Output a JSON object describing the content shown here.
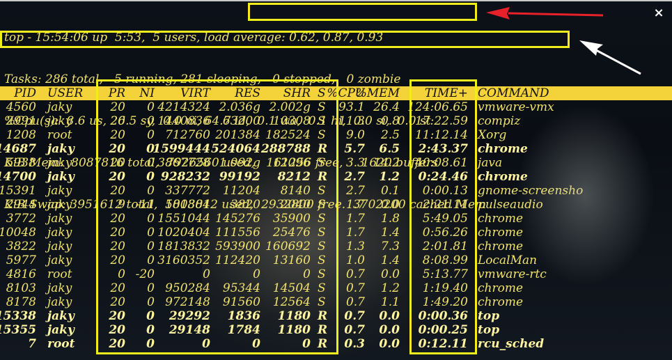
{
  "summary": {
    "line1": "top - 15:54:06 up  5:53,  5 users,",
    "load": " load average: 0.62, 0.87, 0.93",
    "tasks": "Tasks: 286 total,   5 running, 281 sleeping,   0 stopped,   0 zombie",
    "cpu": "%Cpu(s):  8.6 us, 26.5 sy,  0.0 ni, 64.7 id,  0.1 wa,  0.1 hi,  0.0 si,  0.0 st",
    "mem": "KiB Mem:  8087816 total,  7926560 used,   161256 free,     1620 buffers",
    "swap": "KiB Swap: 3951612 total,  1018812 used,  2932800 free.  3702200 cached Mem"
  },
  "columns": [
    "PID",
    "USER",
    "PR",
    "NI",
    "VIRT",
    "RES",
    "SHR",
    "S",
    "%CPU",
    "%MEM",
    "TIME+",
    "COMMAND"
  ],
  "processes": [
    {
      "pid": "4560",
      "user": "jaky",
      "pr": "20",
      "ni": "0",
      "virt": "4214324",
      "res": "2.036g",
      "shr": "2.002g",
      "s": "S",
      "cpu": "93.1",
      "mem": "26.4",
      "time": "124:06.65",
      "cmd": "vmware-vmx",
      "bold": false
    },
    {
      "pid": "2991",
      "user": "jaky",
      "pr": "20",
      "ni": "0",
      "virt": "1440836",
      "res": "63200",
      "shr": "10308",
      "s": "S",
      "cpu": "11.3",
      "mem": "0.8",
      "time": "17:22.59",
      "cmd": "compiz",
      "bold": false
    },
    {
      "pid": "1208",
      "user": "root",
      "pr": "20",
      "ni": "0",
      "virt": "712760",
      "res": "201384",
      "shr": "182524",
      "s": "S",
      "cpu": "9.0",
      "mem": "2.5",
      "time": "11:12.14",
      "cmd": "Xorg",
      "bold": false
    },
    {
      "pid": "14687",
      "user": "jaky",
      "pr": "20",
      "ni": "0",
      "virt": "1599444",
      "res": "524064",
      "shr": "288788",
      "s": "R",
      "cpu": "5.7",
      "mem": "6.5",
      "time": "2:43.37",
      "cmd": "chrome",
      "bold": true
    },
    {
      "pid": "5938",
      "user": "jaky",
      "pr": "20",
      "ni": "0",
      "virt": "3867728",
      "res": "1.092g",
      "shr": "12096",
      "s": "S",
      "cpu": "3.3",
      "mem": "14.2",
      "time": "40:08.61",
      "cmd": "java",
      "bold": false
    },
    {
      "pid": "14700",
      "user": "jaky",
      "pr": "20",
      "ni": "0",
      "virt": "928232",
      "res": "99192",
      "shr": "8212",
      "s": "R",
      "cpu": "2.7",
      "mem": "1.2",
      "time": "0:24.46",
      "cmd": "chrome",
      "bold": true
    },
    {
      "pid": "15391",
      "user": "jaky",
      "pr": "20",
      "ni": "0",
      "virt": "337772",
      "res": "11204",
      "shr": "8140",
      "s": "S",
      "cpu": "2.7",
      "mem": "0.1",
      "time": "0:00.13",
      "cmd": "gnome-screensho",
      "bold": false
    },
    {
      "pid": "2944",
      "user": "jaky",
      "pr": "9",
      "ni": "-11",
      "virt": "580304",
      "res": "3820",
      "shr": "2040",
      "s": "S",
      "cpu": "1.7",
      "mem": "0.0",
      "time": "2:21.11",
      "cmd": "pulseaudio",
      "bold": false
    },
    {
      "pid": "3772",
      "user": "jaky",
      "pr": "20",
      "ni": "0",
      "virt": "1551044",
      "res": "145276",
      "shr": "35900",
      "s": "S",
      "cpu": "1.7",
      "mem": "1.8",
      "time": "5:49.05",
      "cmd": "chrome",
      "bold": false
    },
    {
      "pid": "10048",
      "user": "jaky",
      "pr": "20",
      "ni": "0",
      "virt": "1020404",
      "res": "111556",
      "shr": "25476",
      "s": "S",
      "cpu": "1.7",
      "mem": "1.4",
      "time": "0:56.26",
      "cmd": "chrome",
      "bold": false
    },
    {
      "pid": "3822",
      "user": "jaky",
      "pr": "20",
      "ni": "0",
      "virt": "1813832",
      "res": "593900",
      "shr": "160692",
      "s": "S",
      "cpu": "1.3",
      "mem": "7.3",
      "time": "2:01.81",
      "cmd": "chrome",
      "bold": false
    },
    {
      "pid": "5977",
      "user": "jaky",
      "pr": "20",
      "ni": "0",
      "virt": "3160352",
      "res": "112420",
      "shr": "13160",
      "s": "S",
      "cpu": "1.0",
      "mem": "1.4",
      "time": "8:08.99",
      "cmd": "LocalMan",
      "bold": false
    },
    {
      "pid": "4816",
      "user": "root",
      "pr": "0",
      "ni": "-20",
      "virt": "0",
      "res": "0",
      "shr": "0",
      "s": "S",
      "cpu": "0.7",
      "mem": "0.0",
      "time": "5:13.77",
      "cmd": "vmware-rtc",
      "bold": false
    },
    {
      "pid": "8103",
      "user": "jaky",
      "pr": "20",
      "ni": "0",
      "virt": "950284",
      "res": "95344",
      "shr": "14504",
      "s": "S",
      "cpu": "0.7",
      "mem": "1.2",
      "time": "1:19.40",
      "cmd": "chrome",
      "bold": false
    },
    {
      "pid": "8178",
      "user": "jaky",
      "pr": "20",
      "ni": "0",
      "virt": "972148",
      "res": "91560",
      "shr": "12564",
      "s": "S",
      "cpu": "0.7",
      "mem": "1.1",
      "time": "1:49.20",
      "cmd": "chrome",
      "bold": false
    },
    {
      "pid": "15338",
      "user": "jaky",
      "pr": "20",
      "ni": "0",
      "virt": "29292",
      "res": "1836",
      "shr": "1180",
      "s": "R",
      "cpu": "0.7",
      "mem": "0.0",
      "time": "0:00.36",
      "cmd": "top",
      "bold": true
    },
    {
      "pid": "15355",
      "user": "jaky",
      "pr": "20",
      "ni": "0",
      "virt": "29148",
      "res": "1784",
      "shr": "1180",
      "s": "R",
      "cpu": "0.7",
      "mem": "0.0",
      "time": "0:00.25",
      "cmd": "top",
      "bold": true
    },
    {
      "pid": "7",
      "user": "root",
      "pr": "20",
      "ni": "0",
      "virt": "0",
      "res": "0",
      "shr": "0",
      "s": "R",
      "cpu": "0.3",
      "mem": "0.0",
      "time": "0:12.11",
      "cmd": "rcu_sched",
      "bold": true
    }
  ],
  "close_icon": "×",
  "colors": {
    "text": "#f0e26e",
    "header_bg": "#f3d23a",
    "highlight_box": "#f1ec1c",
    "arrow_red": "#e8202a",
    "arrow_white": "#ffffff"
  }
}
